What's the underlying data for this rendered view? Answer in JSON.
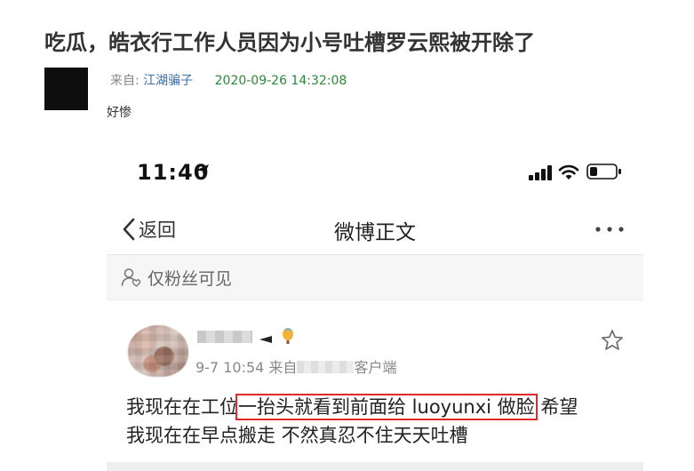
{
  "post": {
    "title": "吃瓜，皓衣行工作人员因为小号吐槽罗云熙被开除了",
    "from_label": "来自:",
    "author": "江湖骗子",
    "timestamp": "2020-09-26 14:32:08",
    "reply": "好惨"
  },
  "phone": {
    "status_bar": {
      "time": "11:40"
    },
    "nav": {
      "back_label": "返回",
      "title": "微博正文"
    },
    "visibility": "仅粉丝可见",
    "weibo": {
      "time": "9-7 10:54",
      "source_prefix": "来自",
      "source_suffix": "客户端",
      "body": {
        "before": "我现在在工位",
        "highlighted": "一抬头就看到前面给 luoyunxi 做脸",
        "after": "希望",
        "line2": "我现在在早点搬走 不然真忍不住天天吐槽"
      }
    }
  },
  "colors": {
    "author_link": "#3a6fb0",
    "timestamp": "#2a8a3a",
    "highlight_box": "#e0292a"
  }
}
